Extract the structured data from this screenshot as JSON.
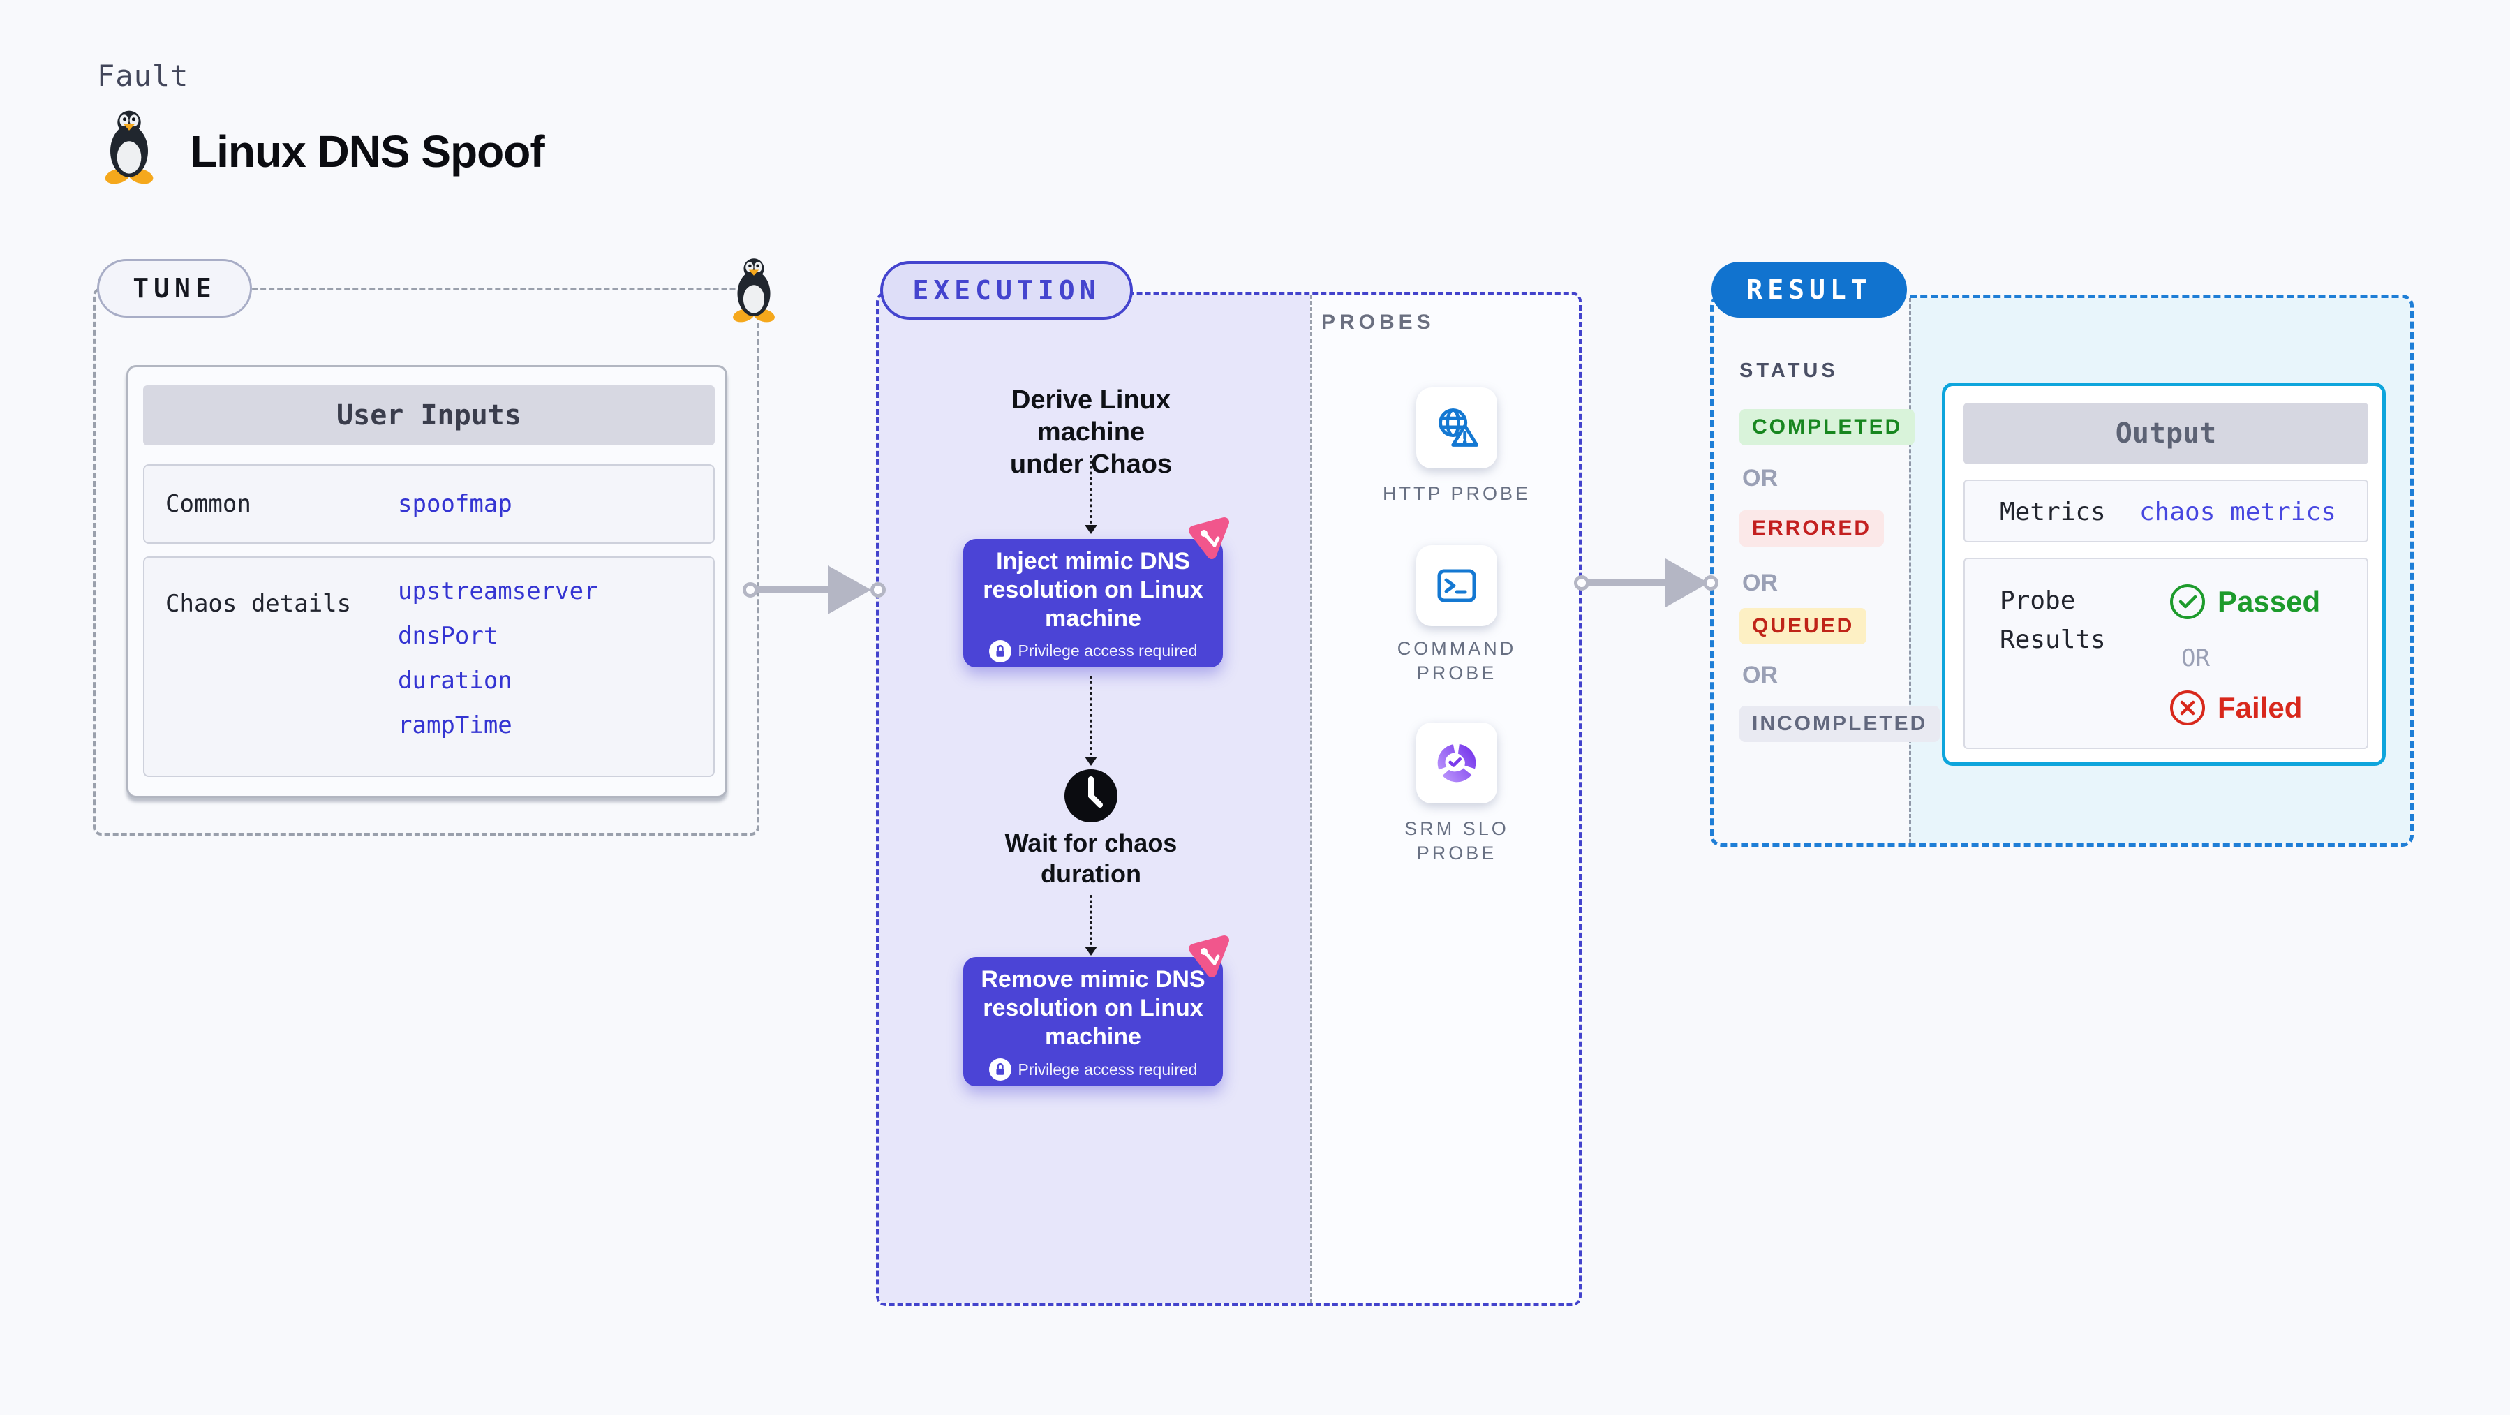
{
  "header": {
    "eyebrow": "Fault",
    "title": "Linux DNS Spoof"
  },
  "tune": {
    "badge": "TUNE",
    "table": {
      "title": "User Inputs",
      "common_label": "Common",
      "common_value": "spoofmap",
      "chaos_label": "Chaos details",
      "chaos_values": [
        "upstreamserver",
        "dnsPort",
        "duration",
        "rampTime"
      ]
    }
  },
  "execution": {
    "badge": "EXECUTION",
    "derive": {
      "line1": "Derive Linux machine",
      "line2": "under Chaos"
    },
    "inject_text": "Inject mimic DNS resolution on Linux machine",
    "remove_text": "Remove mimic DNS resolution on Linux machine",
    "privilege": "Privilege access required",
    "wait": {
      "line1": "Wait for chaos",
      "line2": "duration"
    }
  },
  "probes": {
    "title": "PROBES",
    "items": [
      {
        "icon": "globe-alert-icon",
        "line1": "HTTP PROBE",
        "line2": ""
      },
      {
        "icon": "terminal-icon",
        "line1": "COMMAND",
        "line2": "PROBE"
      },
      {
        "icon": "slo-donut-icon",
        "line1": "SRM SLO",
        "line2": "PROBE"
      }
    ]
  },
  "result": {
    "badge": "RESULT",
    "status_title": "STATUS",
    "or_label": "OR",
    "statuses": [
      {
        "label": "COMPLETED",
        "fg": "#17861f",
        "bg": "#d9f3da"
      },
      {
        "label": "ERRORED",
        "fg": "#c32020",
        "bg": "#fbe8e8"
      },
      {
        "label": "QUEUED",
        "fg": "#bf2418",
        "bg": "#fdf0c4"
      },
      {
        "label": "INCOMPLETED",
        "fg": "#62687e",
        "bg": "#e9eaf2"
      }
    ],
    "output": {
      "title": "Output",
      "metrics_label": "Metrics",
      "metrics_value": "chaos metrics",
      "probe_label_line1": "Probe",
      "probe_label_line2": "Results",
      "passed": "Passed",
      "or": "OR",
      "failed": "Failed"
    }
  },
  "colors": {
    "page_bg": "#f8f9fc",
    "accent_indigo": "#4444ce",
    "node_fill": "#4b44d6",
    "lavender_bg": "#e7e6fa",
    "result_blue": "#1173cf",
    "cyan_border": "#0ea5dc",
    "cyan_bg": "#e8f5fb",
    "probe_blue": "#1478d2",
    "srm_purple": "#7a3bec",
    "chaos_pink": "#f1568c",
    "value_blue": "#3434d2",
    "passed_green": "#1d9b2c",
    "failed_red": "#d8281c",
    "arrow_gray": "#b4b6c4",
    "tux_yellow": "#f5a81c"
  }
}
